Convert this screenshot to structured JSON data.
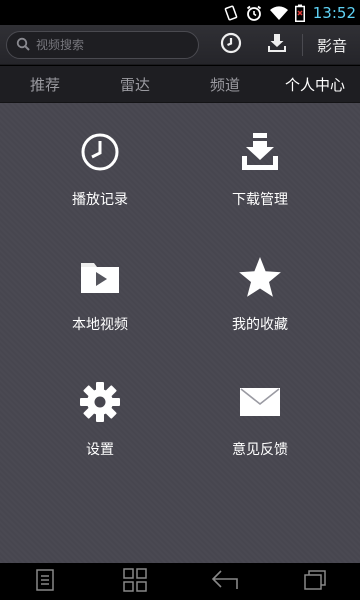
{
  "status_bar": {
    "time": "13:52",
    "icons": [
      "rotate-icon",
      "alarm-icon",
      "wifi-icon",
      "battery-empty-icon"
    ],
    "time_color": "#5fd2f5"
  },
  "toolbar": {
    "search_placeholder": "视频搜索",
    "icons": [
      "history-clock-icon",
      "download-icon"
    ],
    "cinema_label": "影音"
  },
  "tabs": [
    {
      "label": "推荐",
      "active": false
    },
    {
      "label": "雷达",
      "active": false
    },
    {
      "label": "频道",
      "active": false
    },
    {
      "label": "个人中心",
      "active": true
    }
  ],
  "menu": [
    {
      "label": "播放记录",
      "icon": "history-clock-icon"
    },
    {
      "label": "下载管理",
      "icon": "download-tray-icon"
    },
    {
      "label": "本地视频",
      "icon": "local-video-folder-icon"
    },
    {
      "label": "我的收藏",
      "icon": "star-icon"
    },
    {
      "label": "设置",
      "icon": "gear-icon"
    },
    {
      "label": "意见反馈",
      "icon": "mail-envelope-icon"
    }
  ],
  "navbar": {
    "icons": [
      "menu-icon",
      "home-grid-icon",
      "back-icon",
      "recent-apps-icon"
    ]
  },
  "colors": {
    "content_bg": "#47464f",
    "tab_bar_bg": "#1e1e22",
    "active_tab": "#ffffff",
    "inactive_tab": "#9a9aa0"
  }
}
